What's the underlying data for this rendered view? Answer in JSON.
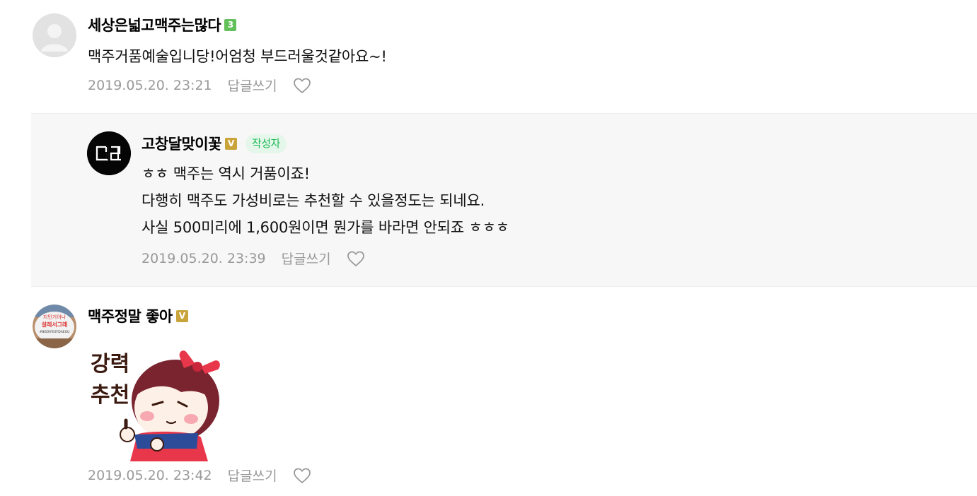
{
  "comments": [
    {
      "nickname": "세상은넓고맥주는많다",
      "level_badge": "3",
      "text_lines": [
        "맥주거품예술입니당!어엄청 부드러울것같아요~!"
      ],
      "date": "2019.05.20. 23:21",
      "reply_label": "답글쓰기",
      "like_icon": "heart-outline-icon"
    },
    {
      "nickname": "고창달맞이꽃",
      "level_badge": "V",
      "author_badge": "작성자",
      "avatar_text": "ᄀᄃ",
      "text_lines": [
        "ㅎㅎ 맥주는 역시 거품이죠!",
        "다행히 맥주도 가성비로는 추천할 수 있을정도는 되네요.",
        "사실 500미리에 1,600원이면 뭔가를 바라면 안되죠 ㅎㅎㅎ"
      ],
      "date": "2019.05.20. 23:39",
      "reply_label": "답글쓰기",
      "like_icon": "heart-outline-icon"
    },
    {
      "nickname": "맥주정말 좋아",
      "level_badge": "V",
      "avatar_lines": [
        "지민거어나",
        "설레서그래",
        "#BEERFESTDAEGU"
      ],
      "sticker_lines": [
        "강력",
        "추천"
      ],
      "date": "2019.05.20. 23:42",
      "reply_label": "답글쓰기",
      "like_icon": "heart-outline-icon"
    }
  ],
  "colors": {
    "reply_bg": "#f7f7f7",
    "author_badge_bg": "#e4f7ea",
    "author_badge_text": "#1db954",
    "level_green": "#64c05b",
    "level_gold": "#c9a43a",
    "meta_gray": "#999999"
  }
}
